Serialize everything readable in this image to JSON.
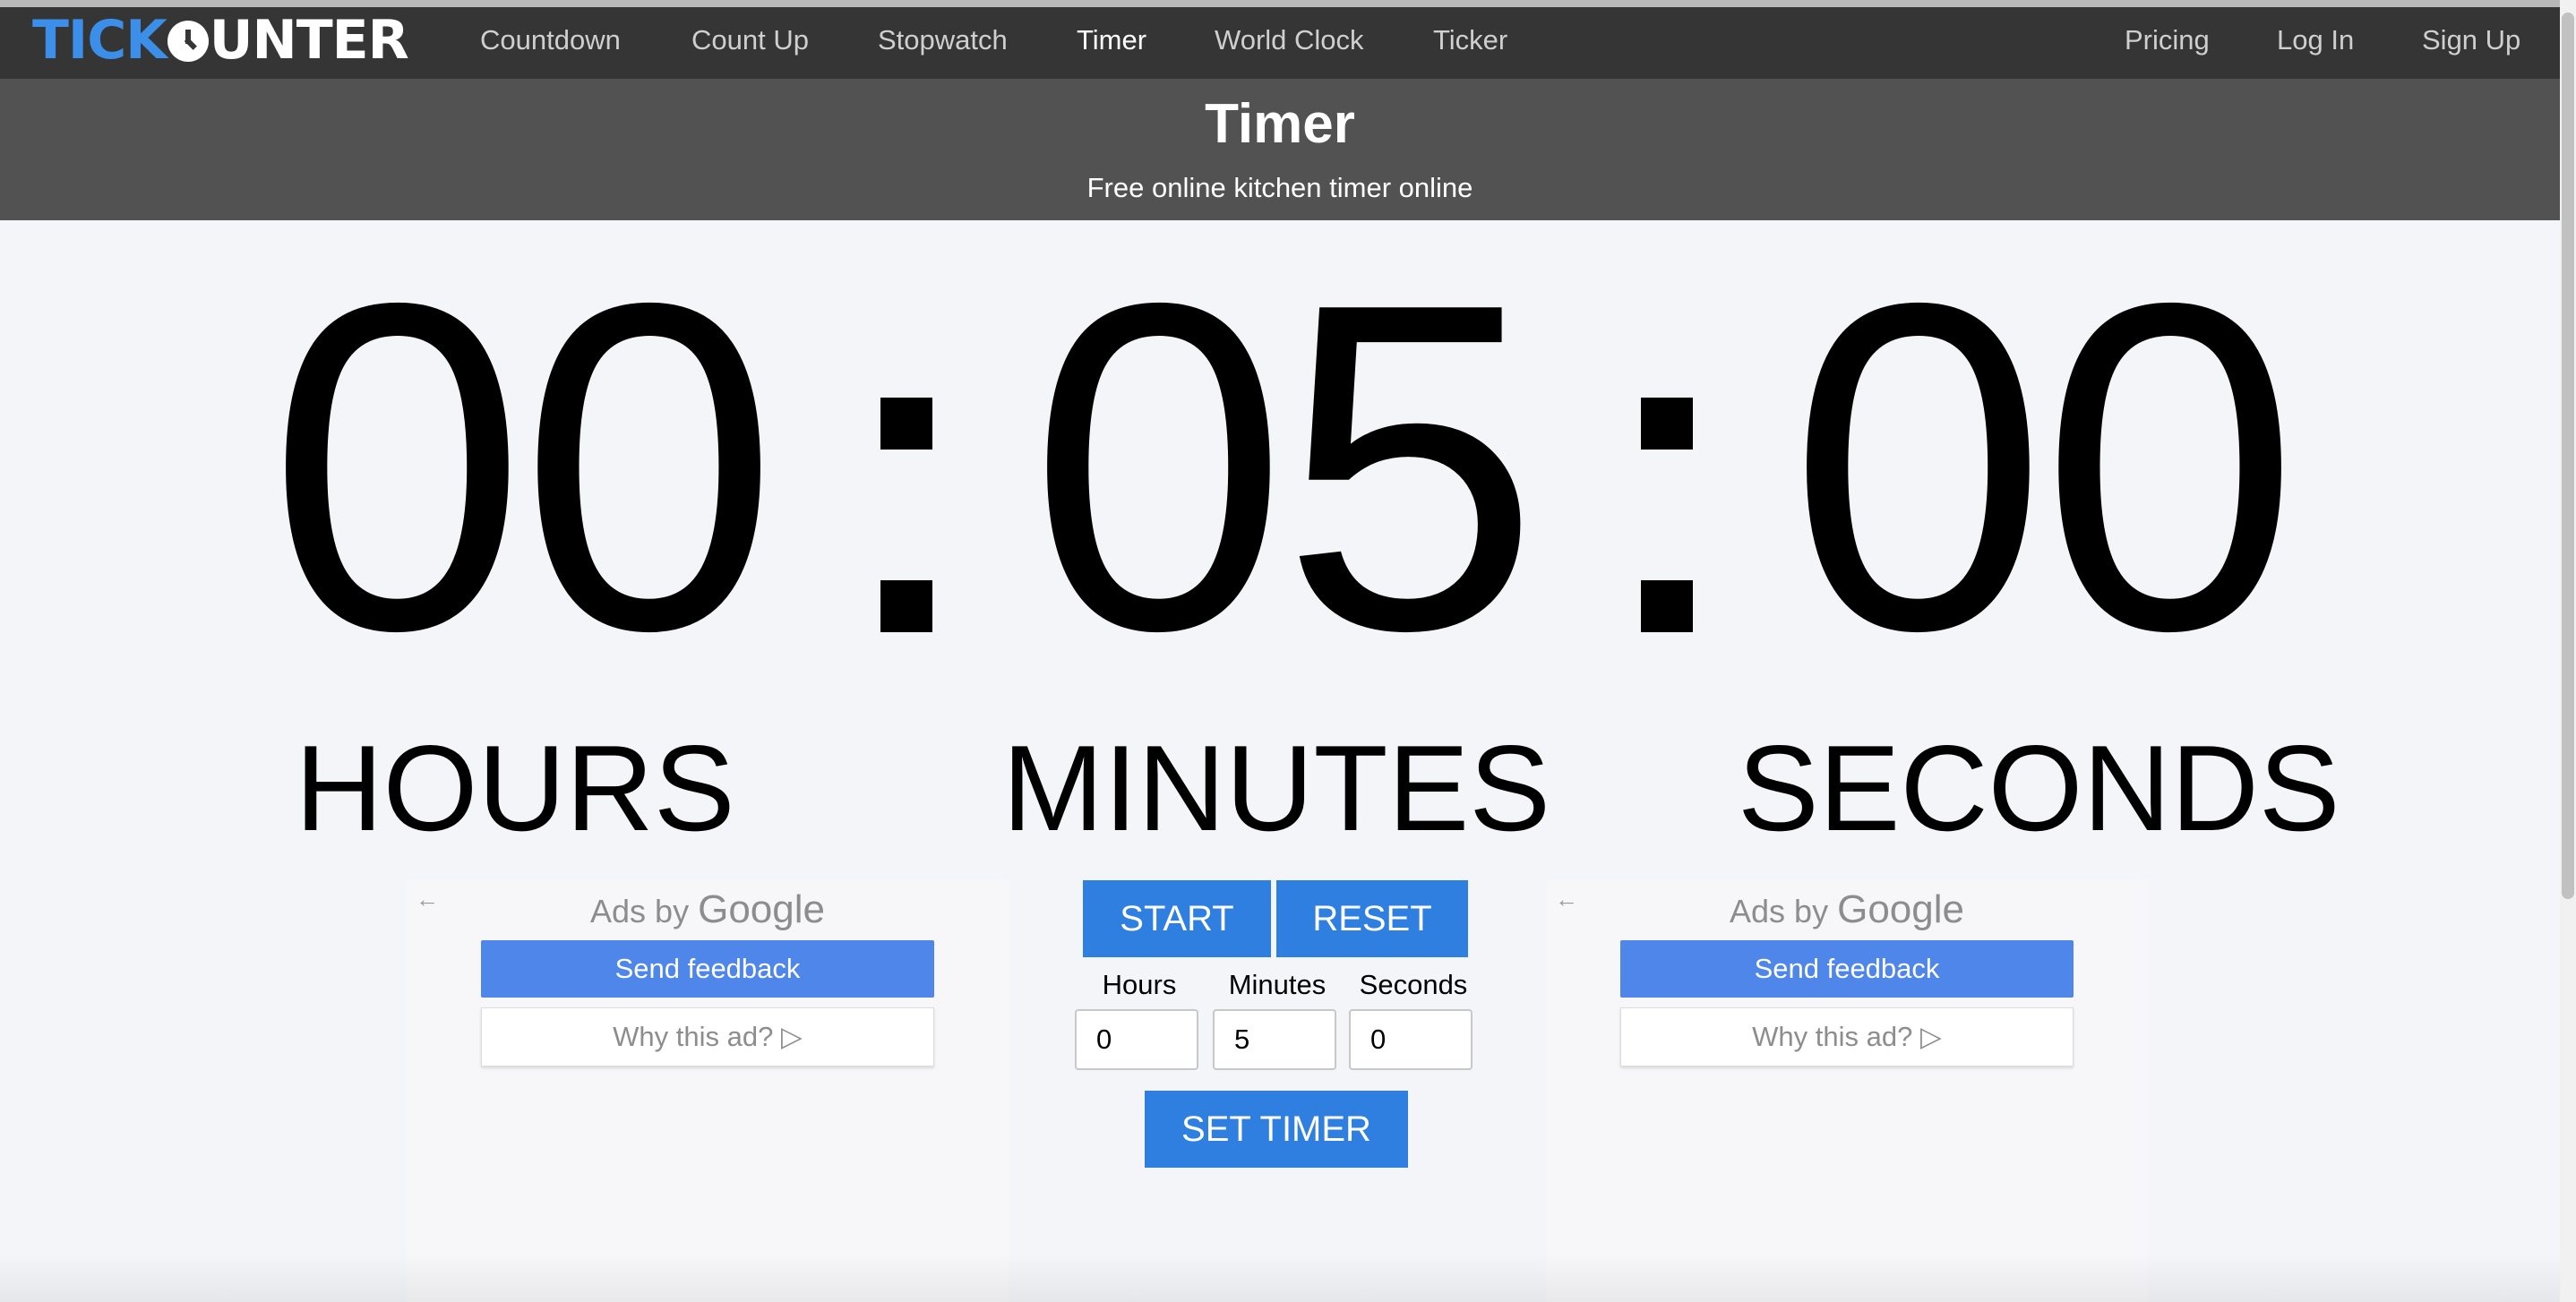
{
  "brand": {
    "tick": "TICK",
    "c": "C",
    "unter": "UNTER"
  },
  "nav": {
    "left": [
      "Countdown",
      "Count Up",
      "Stopwatch",
      "Timer",
      "World Clock",
      "Ticker"
    ],
    "active": "Timer",
    "right": [
      "Pricing",
      "Log In",
      "Sign Up"
    ]
  },
  "header": {
    "title": "Timer",
    "subtitle": "Free online kitchen timer online"
  },
  "display": {
    "hours": "00",
    "minutes": "05",
    "seconds": "00",
    "labels": {
      "hours": "HOURS",
      "minutes": "MINUTES",
      "seconds": "SECONDS"
    }
  },
  "ads": {
    "ads_by": "Ads by",
    "google": "Google",
    "send_feedback": "Send feedback",
    "why": "Why this ad?",
    "back_glyph": "←",
    "why_glyph": "▷"
  },
  "controls": {
    "start": "START",
    "reset": "RESET",
    "set_timer": "SET TIMER",
    "fields": {
      "hours_label": "Hours",
      "hours_value": "0",
      "minutes_label": "Minutes",
      "minutes_value": "5",
      "seconds_label": "Seconds",
      "seconds_value": "0"
    }
  },
  "colors": {
    "accent": "#2f7fe0",
    "nav_bg": "#353535",
    "header_bg": "#525252",
    "brand_blue": "#3b8fe8"
  }
}
